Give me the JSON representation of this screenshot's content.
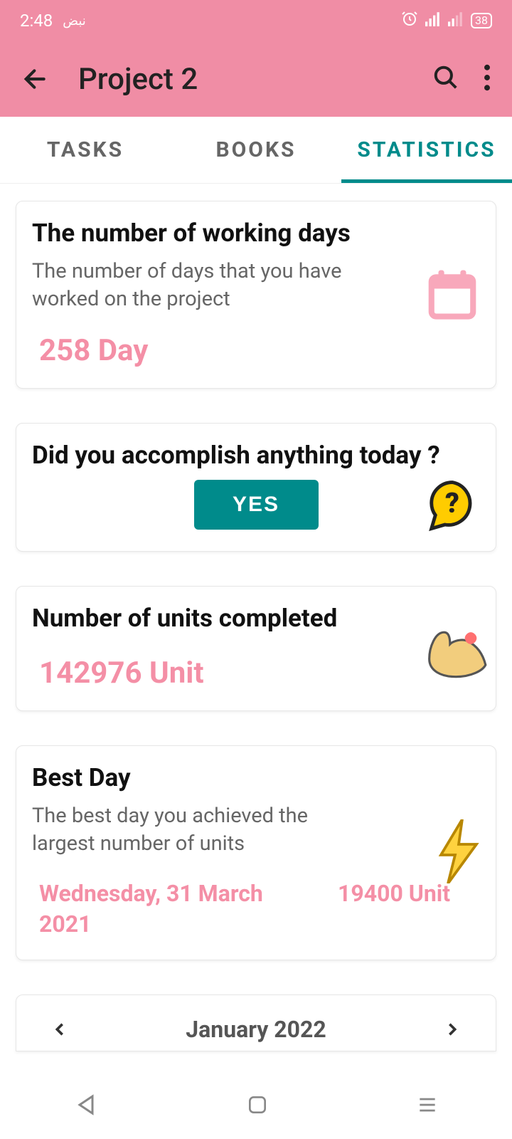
{
  "status": {
    "time": "2:48",
    "extra": "نبض",
    "battery": "38"
  },
  "header": {
    "title": "Project 2"
  },
  "tabs": {
    "tasks": "TASKS",
    "books": "BOOKS",
    "statistics": "STATISTICS"
  },
  "cards": {
    "working_days": {
      "title": "The number of working days",
      "subtitle": "The number of days that you have worked on the project",
      "value": "258 Day"
    },
    "today": {
      "title": "Did you accomplish anything today ?",
      "yes": "YES"
    },
    "units": {
      "title": "Number of units completed",
      "value": "142976 Unit"
    },
    "best_day": {
      "title": "Best Day",
      "subtitle": "The best day you achieved the largest number of units",
      "date": "Wednesday, 31 March 2021",
      "units": "19400 Unit"
    }
  },
  "calendar": {
    "label": "January 2022"
  }
}
